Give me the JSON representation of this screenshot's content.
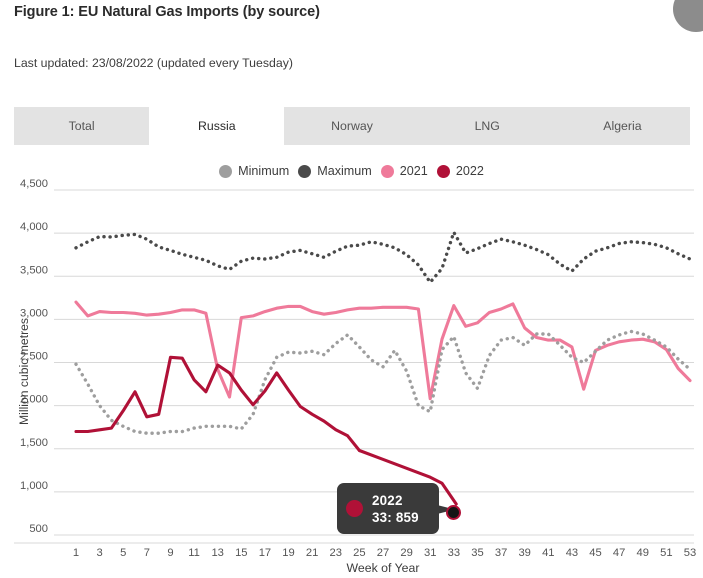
{
  "header": {
    "title": "Figure 1: EU Natural Gas Imports (by source)",
    "last_updated": "Last updated: 23/08/2022 (updated every Tuesday)",
    "corner_widget_icon": "more-options-icon"
  },
  "tabs": [
    {
      "label": "Total",
      "active": false
    },
    {
      "label": "Russia",
      "active": true
    },
    {
      "label": "Norway",
      "active": false
    },
    {
      "label": "LNG",
      "active": false
    },
    {
      "label": "Algeria",
      "active": false
    }
  ],
  "tooltip": {
    "series_label": "2022",
    "value_label": "33: 859",
    "dot_color": "#b01137"
  },
  "colors": {
    "minimum": "#9e9e9e",
    "maximum": "#4a4a4a",
    "y2021": "#ef7a9a",
    "y2022": "#b01137",
    "grid": "#d8d8d8",
    "tab_bar": "#e3e3e3",
    "tab_active": "#ffffff"
  },
  "chart_data": {
    "type": "line",
    "title": "Figure 1: EU Natural Gas Imports (by source)",
    "subtitle": "Russia",
    "xlabel": "Week of Year",
    "ylabel": "Million cubic metres",
    "ylim": [
      500,
      4500
    ],
    "ytick_labels": [
      "4,500",
      "4,000",
      "3,500",
      "3,000",
      "2,500",
      "2,000",
      "1,500",
      "1,000",
      "500"
    ],
    "yticks": [
      4500,
      4000,
      3500,
      3000,
      2500,
      2000,
      1500,
      1000,
      500
    ],
    "xlim": [
      1,
      53
    ],
    "xticks": [
      1,
      3,
      5,
      7,
      9,
      11,
      13,
      15,
      17,
      19,
      21,
      23,
      25,
      27,
      29,
      31,
      33,
      35,
      37,
      39,
      41,
      43,
      45,
      47,
      49,
      51,
      53
    ],
    "grid": true,
    "legend_position": "top-center",
    "x": [
      1,
      2,
      3,
      4,
      5,
      6,
      7,
      8,
      9,
      10,
      11,
      12,
      13,
      14,
      15,
      16,
      17,
      18,
      19,
      20,
      21,
      22,
      23,
      24,
      25,
      26,
      27,
      28,
      29,
      30,
      31,
      32,
      33,
      34,
      35,
      36,
      37,
      38,
      39,
      40,
      41,
      42,
      43,
      44,
      45,
      46,
      47,
      48,
      49,
      50,
      51,
      52,
      53
    ],
    "series": [
      {
        "name": "Maximum",
        "style": "dotted",
        "color": "#4a4a4a",
        "values": [
          3830,
          3900,
          3960,
          3955,
          3975,
          3985,
          3930,
          3840,
          3800,
          3755,
          3720,
          3685,
          3620,
          3580,
          3675,
          3710,
          3700,
          3720,
          3780,
          3800,
          3760,
          3720,
          3790,
          3850,
          3860,
          3900,
          3870,
          3830,
          3750,
          3630,
          3430,
          3590,
          4010,
          3770,
          3820,
          3880,
          3930,
          3900,
          3860,
          3810,
          3750,
          3640,
          3560,
          3700,
          3790,
          3830,
          3880,
          3900,
          3890,
          3870,
          3830,
          3760,
          3700
        ]
      },
      {
        "name": "2021",
        "style": "solid",
        "color": "#ef7a9a",
        "values": [
          3200,
          3040,
          3090,
          3080,
          3080,
          3070,
          3050,
          3060,
          3080,
          3110,
          3110,
          3070,
          2420,
          2100,
          3020,
          3040,
          3090,
          3130,
          3150,
          3150,
          3090,
          3060,
          3080,
          3110,
          3130,
          3130,
          3140,
          3140,
          3140,
          3120,
          2080,
          2770,
          3160,
          2920,
          2960,
          3080,
          3120,
          3180,
          2900,
          2790,
          2760,
          2760,
          2680,
          2190,
          2640,
          2700,
          2740,
          2760,
          2770,
          2740,
          2650,
          2430,
          2290
        ]
      },
      {
        "name": "Minimum",
        "style": "dotted",
        "color": "#9e9e9e",
        "values": [
          2480,
          2250,
          2000,
          1830,
          1760,
          1700,
          1680,
          1680,
          1700,
          1700,
          1740,
          1760,
          1760,
          1760,
          1730,
          1900,
          2300,
          2560,
          2620,
          2610,
          2630,
          2590,
          2720,
          2820,
          2680,
          2530,
          2450,
          2640,
          2400,
          2000,
          1930,
          2650,
          2800,
          2380,
          2200,
          2580,
          2760,
          2790,
          2700,
          2830,
          2830,
          2700,
          2560,
          2500,
          2630,
          2760,
          2820,
          2860,
          2830,
          2760,
          2680,
          2540,
          2420
        ]
      },
      {
        "name": "2022",
        "style": "solid",
        "color": "#b01137",
        "values": [
          1700,
          1700,
          1720,
          1740,
          1940,
          2160,
          1870,
          1900,
          2560,
          2550,
          2300,
          2160,
          2470,
          2380,
          2180,
          2010,
          2170,
          2380,
          2180,
          1990,
          1900,
          1820,
          1720,
          1650,
          1480,
          null,
          null,
          null,
          null,
          null,
          null,
          null,
          859,
          null,
          null,
          null,
          null,
          null,
          null,
          null,
          null,
          null,
          null,
          null,
          null,
          null,
          null,
          null,
          null,
          null,
          null,
          null,
          null
        ],
        "note": "2022 series is plotted to week 25 then a trailing segment descends to the highlighted point at week 33 (859)"
      }
    ],
    "highlight_point": {
      "series": "2022",
      "x": 33,
      "y": 859,
      "label": "33: 859"
    }
  }
}
